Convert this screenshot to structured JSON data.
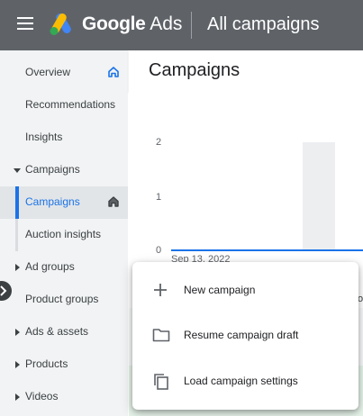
{
  "header": {
    "product_name": "Google",
    "product_suffix": "Ads",
    "page_title": "All campaigns"
  },
  "sidebar": {
    "items": [
      {
        "label": "Overview"
      },
      {
        "label": "Recommendations"
      },
      {
        "label": "Insights"
      },
      {
        "label": "Campaigns"
      },
      {
        "label": "Campaigns"
      },
      {
        "label": "Auction insights"
      },
      {
        "label": "Ad groups"
      },
      {
        "label": "Product groups"
      },
      {
        "label": "Ads & assets"
      },
      {
        "label": "Products"
      },
      {
        "label": "Videos"
      }
    ]
  },
  "main": {
    "title": "Campaigns",
    "chart": {
      "y_ticks": [
        "2",
        "1",
        "0"
      ],
      "x_start_label": "Sep 13, 2022",
      "series_values": [
        0
      ]
    },
    "peek_text": "ol"
  },
  "menu": {
    "items": [
      {
        "label": "New campaign",
        "icon": "plus-icon"
      },
      {
        "label": "Resume campaign draft",
        "icon": "folder-icon"
      },
      {
        "label": "Load campaign settings",
        "icon": "copy-icon"
      }
    ]
  },
  "colors": {
    "topbar": "#5f6368",
    "accent": "#1a73e8",
    "sidebar_bg": "#f1f3f4"
  }
}
